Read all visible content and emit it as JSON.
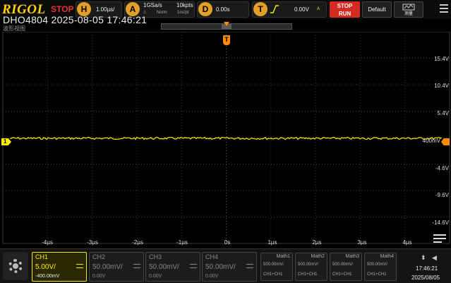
{
  "toolbar": {
    "brand": "RIGOL",
    "run_state": "STOP",
    "horizontal": {
      "badge": "H",
      "timebase": "1.00µs/"
    },
    "acquire": {
      "badge": "A",
      "sample_rate": "1GSa/s",
      "memory_depth": "10kpts",
      "mode": "Norm",
      "interval": "1ns/pt"
    },
    "delay": {
      "badge": "D",
      "value": "0.00s"
    },
    "trigger": {
      "badge": "T",
      "level": "0.00V",
      "source_letter": "A"
    },
    "stop_label": "STOP",
    "run_label": "RUN",
    "default_label": "Default",
    "measure_label": "测量"
  },
  "header": {
    "model_datetime": "DHO4804 2025-08-05 17:46:21",
    "subtitle": "波形视图"
  },
  "memory_window_fraction": 0.5,
  "axes": {
    "y_labels": [
      "15.4V",
      "10.4V",
      "5.4V",
      "400mV",
      "-4.6V",
      "-9.6V",
      "-14.6V"
    ],
    "x_labels": [
      "-4µs",
      "-3µs",
      "-2µs",
      "-1µs",
      "0s",
      "1µs",
      "2µs",
      "3µs",
      "4µs"
    ]
  },
  "markers": {
    "trigger": "T",
    "ch1": "1"
  },
  "channels": [
    {
      "name": "CH1",
      "scale": "5.00V/",
      "offset": "-400.00mV",
      "active": true
    },
    {
      "name": "CH2",
      "scale": "50.00mV/",
      "offset": "0.00V",
      "active": false
    },
    {
      "name": "CH3",
      "scale": "50.00mV/",
      "offset": "0.00V",
      "active": false
    },
    {
      "name": "CH4",
      "scale": "50.00mV/",
      "offset": "0.00V",
      "active": false
    }
  ],
  "math": [
    {
      "name": "Math1",
      "scale": "500.00mV/",
      "expr": "CH1+CH1"
    },
    {
      "name": "Math2",
      "scale": "500.00mV/",
      "expr": "CH1+CH1"
    },
    {
      "name": "Math3",
      "scale": "500.00mV/",
      "expr": "CH1+CH1"
    },
    {
      "name": "Math4",
      "scale": "500.00mV/",
      "expr": "CH1+CH1"
    }
  ],
  "status": {
    "time": "17:46:21",
    "date": "2025/08/05"
  },
  "colors": {
    "ch1": "#ffee00",
    "trigger": "#ff8c00",
    "stop": "#e8322e",
    "grid": "#3a3a3a"
  }
}
